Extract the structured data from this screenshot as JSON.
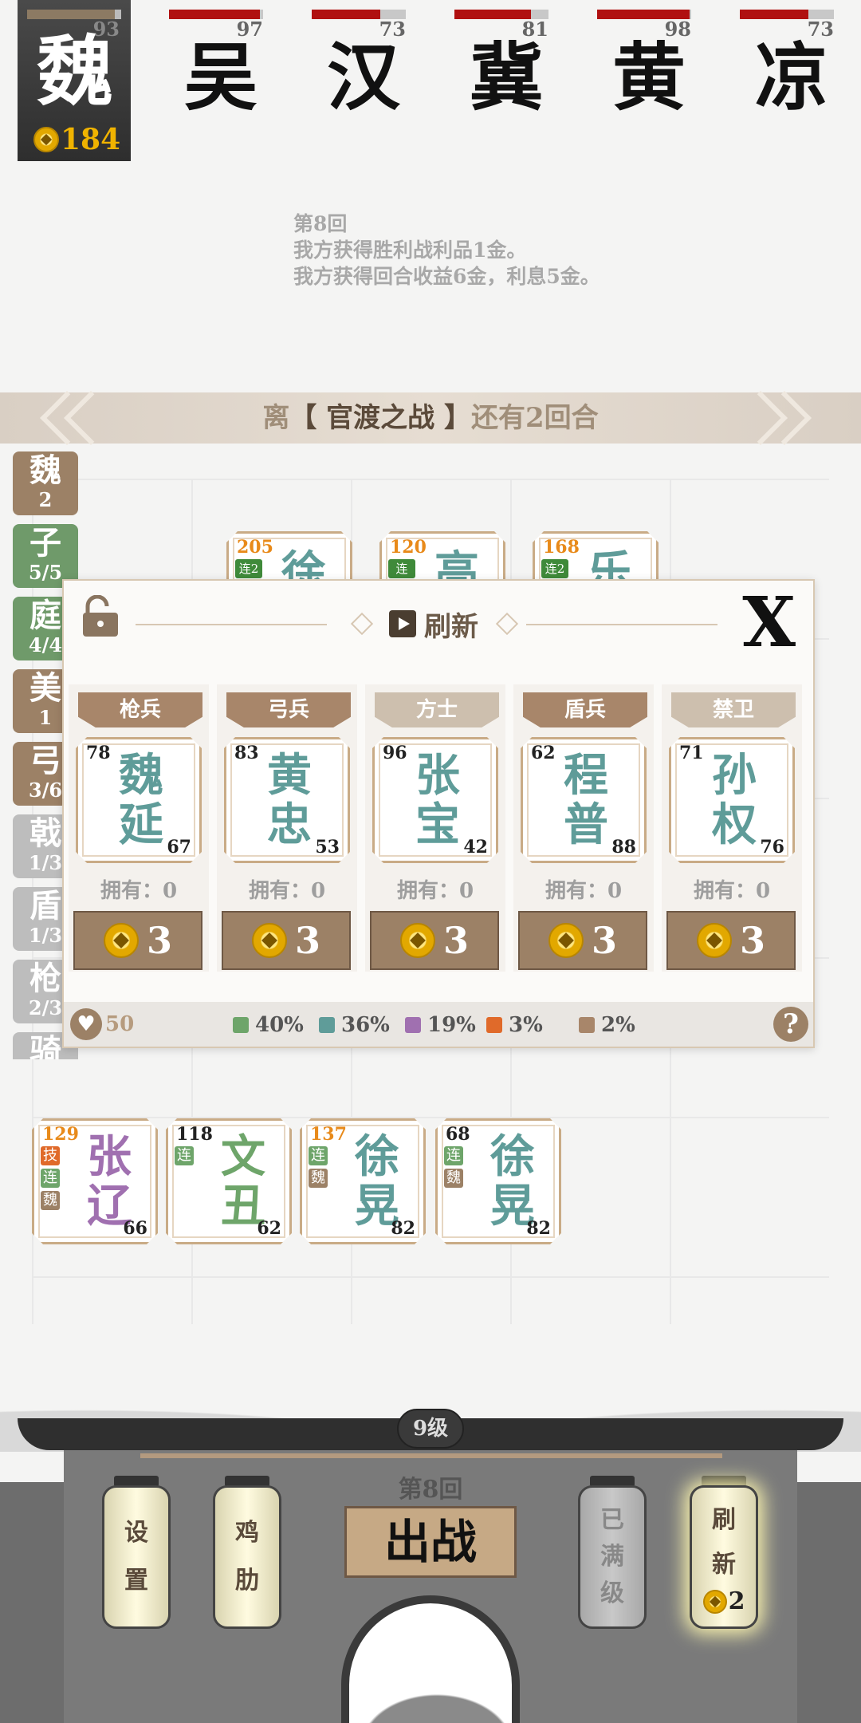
{
  "self": {
    "faction": "魏",
    "hp": 93,
    "hp_pct": 93,
    "gold": "184"
  },
  "enemies": [
    {
      "faction": "吴",
      "hp": 97,
      "hp_pct": 97
    },
    {
      "faction": "汉",
      "hp": 73,
      "hp_pct": 73
    },
    {
      "faction": "冀",
      "hp": 81,
      "hp_pct": 81
    },
    {
      "faction": "黄",
      "hp": 98,
      "hp_pct": 98
    },
    {
      "faction": "凉",
      "hp": 73,
      "hp_pct": 73
    }
  ],
  "log": {
    "line1": "第8回",
    "line2": "我方获得胜利战利品1金。",
    "line3": "我方获得回合收益6金，利息5金。"
  },
  "banner": {
    "prefix": "离",
    "event": "【 官渡之战 】",
    "suffix": "还有2回合"
  },
  "tabs": [
    {
      "name": "魏",
      "count": "2",
      "color": "#9c8166"
    },
    {
      "name": "子",
      "count": "5/5",
      "color": "#6f9a6a"
    },
    {
      "name": "庭",
      "count": "4/4",
      "color": "#6f9a6a"
    },
    {
      "name": "美",
      "count": "1",
      "color": "#9c8166"
    },
    {
      "name": "弓",
      "count": "3/6",
      "color": "#9c8166"
    },
    {
      "name": "戟",
      "count": "1/3",
      "color": "#bdbdbd"
    },
    {
      "name": "盾",
      "count": "1/3",
      "color": "#bdbdbd"
    },
    {
      "name": "枪",
      "count": "2/3",
      "color": "#bdbdbd"
    },
    {
      "name": "骑",
      "count": "",
      "color": "#bdbdbd"
    }
  ],
  "board_top": [
    {
      "atk": "205",
      "name": "徐",
      "badge": "连2"
    },
    {
      "atk": "120",
      "name": "高",
      "badge": "连"
    },
    {
      "atk": "168",
      "name": "乐",
      "badge": "连2"
    }
  ],
  "shop": {
    "title": "刷新",
    "close_label": "X",
    "slots": [
      {
        "cls": "枪兵",
        "cls_color": "#a8866a",
        "atk": "78",
        "def": "67",
        "name1": "魏",
        "name2": "延",
        "owned": "拥有：0",
        "price": "3"
      },
      {
        "cls": "弓兵",
        "cls_color": "#a8866a",
        "atk": "83",
        "def": "53",
        "name1": "黄",
        "name2": "忠",
        "owned": "拥有：0",
        "price": "3"
      },
      {
        "cls": "方士",
        "cls_color": "#cdbfae",
        "atk": "96",
        "def": "42",
        "name1": "张",
        "name2": "宝",
        "owned": "拥有：0",
        "price": "3"
      },
      {
        "cls": "盾兵",
        "cls_color": "#a8866a",
        "atk": "62",
        "def": "88",
        "name1": "程",
        "name2": "普",
        "owned": "拥有：0",
        "price": "3"
      },
      {
        "cls": "禁卫",
        "cls_color": "#cdbfae",
        "atk": "71",
        "def": "76",
        "name1": "孙",
        "name2": "权",
        "owned": "拥有：0",
        "price": "3"
      }
    ],
    "life": "50",
    "odds": [
      {
        "pct": "40%",
        "color": "#6ea56a"
      },
      {
        "pct": "36%",
        "color": "#5f9c99"
      },
      {
        "pct": "19%",
        "color": "#a070b0"
      },
      {
        "pct": "3%",
        "color": "#e06a2a"
      },
      {
        "pct": "2%",
        "color": "#a8866a"
      }
    ],
    "help": "?"
  },
  "bench": [
    {
      "atk": "129",
      "atk_orange": true,
      "name1": "张",
      "name2": "辽",
      "def": "66",
      "color": "#a070b0",
      "badges": [
        {
          "t": "技",
          "c": "#e06a2a"
        },
        {
          "t": "连",
          "c": "#6ea56a"
        },
        {
          "t": "魏",
          "c": "#9c8166"
        }
      ]
    },
    {
      "atk": "118",
      "atk_orange": false,
      "name1": "文",
      "name2": "丑",
      "def": "62",
      "color": "#6ea56a",
      "badges": [
        {
          "t": "连",
          "c": "#6ea56a"
        }
      ]
    },
    {
      "atk": "137",
      "atk_orange": true,
      "name1": "徐",
      "name2": "晃",
      "def": "82",
      "color": "#5f9c99",
      "badges": [
        {
          "t": "连",
          "c": "#6ea56a"
        },
        {
          "t": "魏",
          "c": "#9c8166"
        }
      ]
    },
    {
      "atk": "68",
      "atk_orange": false,
      "name1": "徐",
      "name2": "晃",
      "def": "82",
      "color": "#5f9c99",
      "badges": [
        {
          "t": "连",
          "c": "#6ea56a"
        },
        {
          "t": "魏",
          "c": "#9c8166"
        }
      ]
    }
  ],
  "bottom": {
    "level": "9级",
    "round": "第8回",
    "fight": "出战",
    "settings": [
      "设",
      "置"
    ],
    "chicken": [
      "鸡",
      "肋"
    ],
    "maxed": [
      "已",
      "满",
      "级"
    ],
    "refresh": [
      "刷",
      "新"
    ],
    "refresh_cost": "2"
  }
}
